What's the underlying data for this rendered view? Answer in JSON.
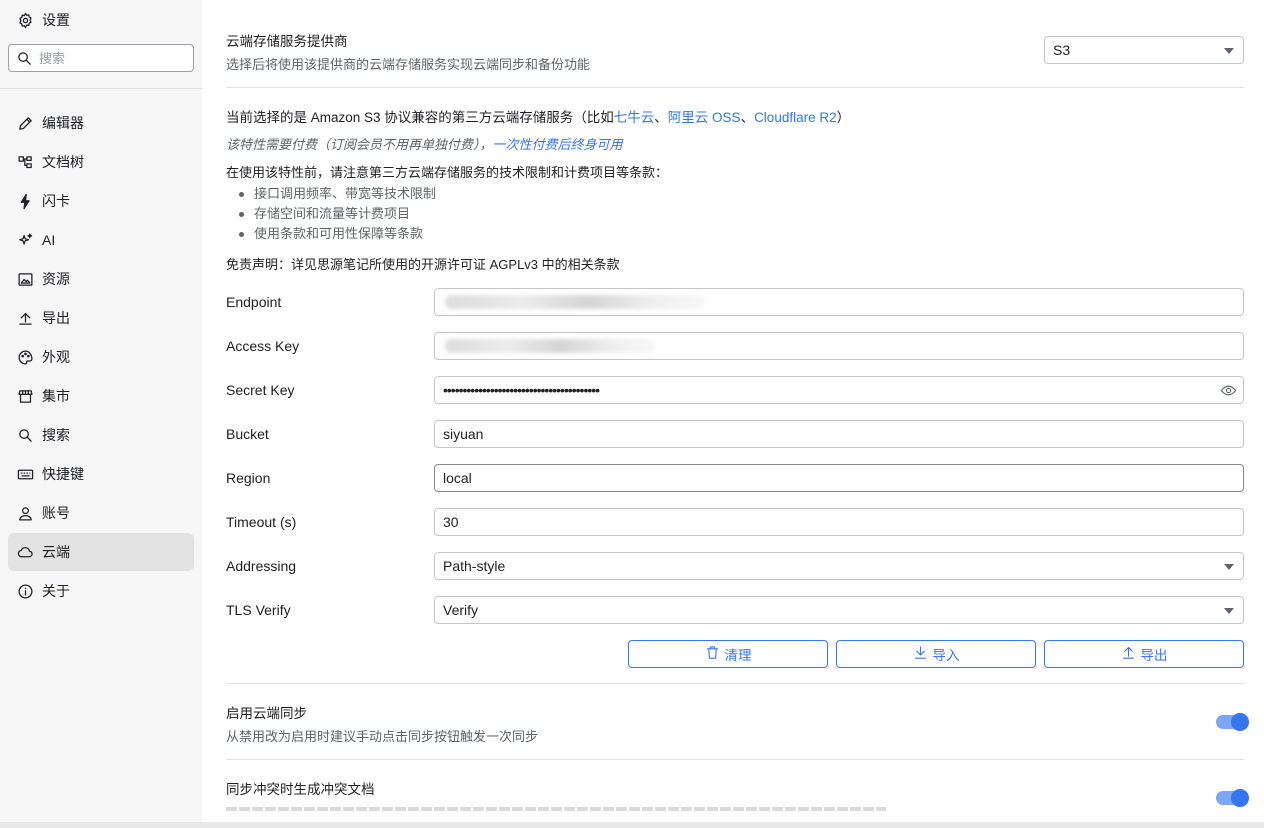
{
  "sidebar": {
    "title": "设置",
    "search_placeholder": "搜索",
    "items": [
      {
        "label": "编辑器"
      },
      {
        "label": "文档树"
      },
      {
        "label": "闪卡"
      },
      {
        "label": "AI"
      },
      {
        "label": "资源"
      },
      {
        "label": "导出"
      },
      {
        "label": "外观"
      },
      {
        "label": "集市"
      },
      {
        "label": "搜索"
      },
      {
        "label": "快捷键"
      },
      {
        "label": "账号"
      },
      {
        "label": "云端"
      },
      {
        "label": "关于"
      }
    ]
  },
  "provider": {
    "title": "云端存储服务提供商",
    "desc": "选择后将使用该提供商的云端存储服务实现云端同步和备份功能",
    "value": "S3"
  },
  "info": {
    "current_prefix": "当前选择的是 Amazon S3 协议兼容的第三方云端存储服务（比如",
    "link1": "七牛云",
    "sep1": "、",
    "link2": "阿里云 OSS",
    "sep2": "、",
    "link3": "Cloudflare R2",
    "suffix": "）",
    "paid_note": "该特性需要付费（订阅会员不用再单独付费），",
    "paid_link": "一次性付费后终身可用",
    "notice": "在使用该特性前，请注意第三方云端存储服务的技术限制和计费项目等条款：",
    "bullets": [
      "接口调用频率、带宽等技术限制",
      "存储空间和流量等计费项目",
      "使用条款和可用性保障等条款"
    ],
    "disclaimer": "免责声明：详见思源笔记所使用的开源许可证 AGPLv3 中的相关条款"
  },
  "form": {
    "endpoint_label": "Endpoint",
    "access_key_label": "Access Key",
    "secret_key_label": "Secret Key",
    "secret_key_value": "••••••••••••••••••••••••••••••••••••••••",
    "bucket_label": "Bucket",
    "bucket_value": "siyuan",
    "region_label": "Region",
    "region_value": "local",
    "timeout_label": "Timeout (s)",
    "timeout_value": "30",
    "addressing_label": "Addressing",
    "addressing_value": "Path-style",
    "tls_label": "TLS Verify",
    "tls_value": "Verify"
  },
  "buttons": {
    "purge": "清理",
    "import": "导入",
    "export": "导出"
  },
  "sync": {
    "title": "启用云端同步",
    "desc": "从禁用改为启用时建议手动点击同步按钮触发一次同步",
    "enabled": true
  },
  "conflict": {
    "title": "同步冲突时生成冲突文档",
    "enabled": true
  },
  "colors": {
    "accent": "#3575f0",
    "sidebar_bg": "#f6f6f6",
    "active_item_bg": "#e3e3e3"
  }
}
